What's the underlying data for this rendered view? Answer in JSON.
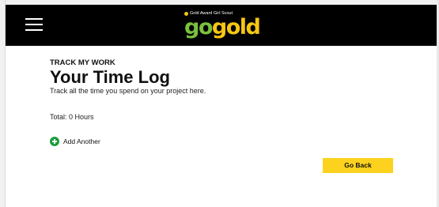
{
  "header": {
    "menu_icon": "hamburger-menu-icon",
    "logo": {
      "tagline": "Gold Award Girl Scout",
      "word_go": "go",
      "word_gold": "gold",
      "colors": {
        "go": "#7bbf3c",
        "gold": "#f6c613",
        "background": "#000000"
      }
    }
  },
  "main": {
    "eyebrow": "TRACK MY WORK",
    "title": "Your Time Log",
    "subtitle": "Track all the time you spend on your project here.",
    "total": "Total: 0 Hours",
    "add_another": {
      "icon": "plus-circle-icon",
      "label": "Add Another",
      "color": "#1e9e3e"
    },
    "go_back": {
      "label": "Go Back",
      "color": "#fdd21f"
    }
  }
}
